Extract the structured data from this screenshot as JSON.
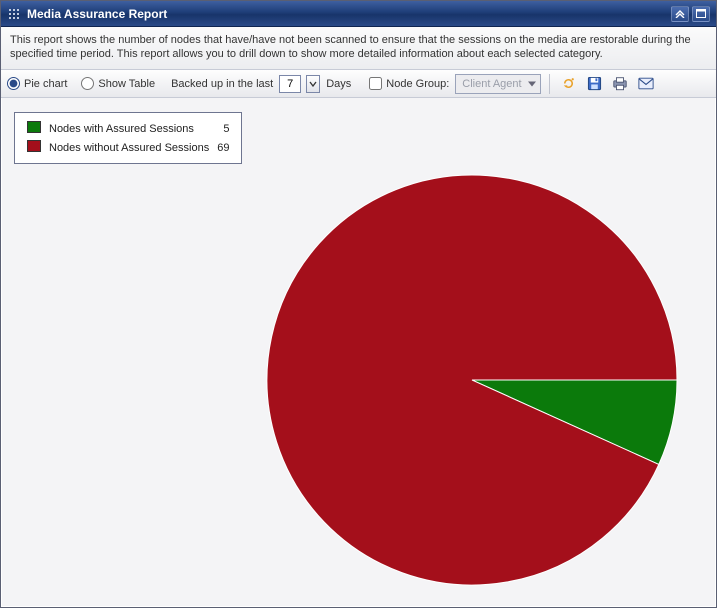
{
  "window": {
    "title": "Media Assurance Report"
  },
  "description": "This report shows the number of nodes that have/have not been scanned to ensure that the sessions on the media are restorable during the specified time period. This report allows you to drill down to show more detailed information about each selected category.",
  "toolbar": {
    "view_pie_label": "Pie chart",
    "view_table_label": "Show Table",
    "backed_label_prefix": "Backed up in the last",
    "backed_label_suffix": "Days",
    "days_value": "7",
    "node_group_label": "Node Group:",
    "node_group_value": "Client Agent"
  },
  "legend": {
    "items": [
      {
        "label": "Nodes with Assured Sessions",
        "value": "5",
        "color": "#0b7a0b"
      },
      {
        "label": "Nodes without Assured Sessions",
        "value": "69",
        "color": "#a40f1b"
      }
    ]
  },
  "chart_data": {
    "type": "pie",
    "title": "Media Assurance Report",
    "categories": [
      "Nodes with Assured Sessions",
      "Nodes without Assured Sessions"
    ],
    "values": [
      5,
      69
    ],
    "colors": [
      "#0b7a0b",
      "#a40f1b"
    ]
  }
}
